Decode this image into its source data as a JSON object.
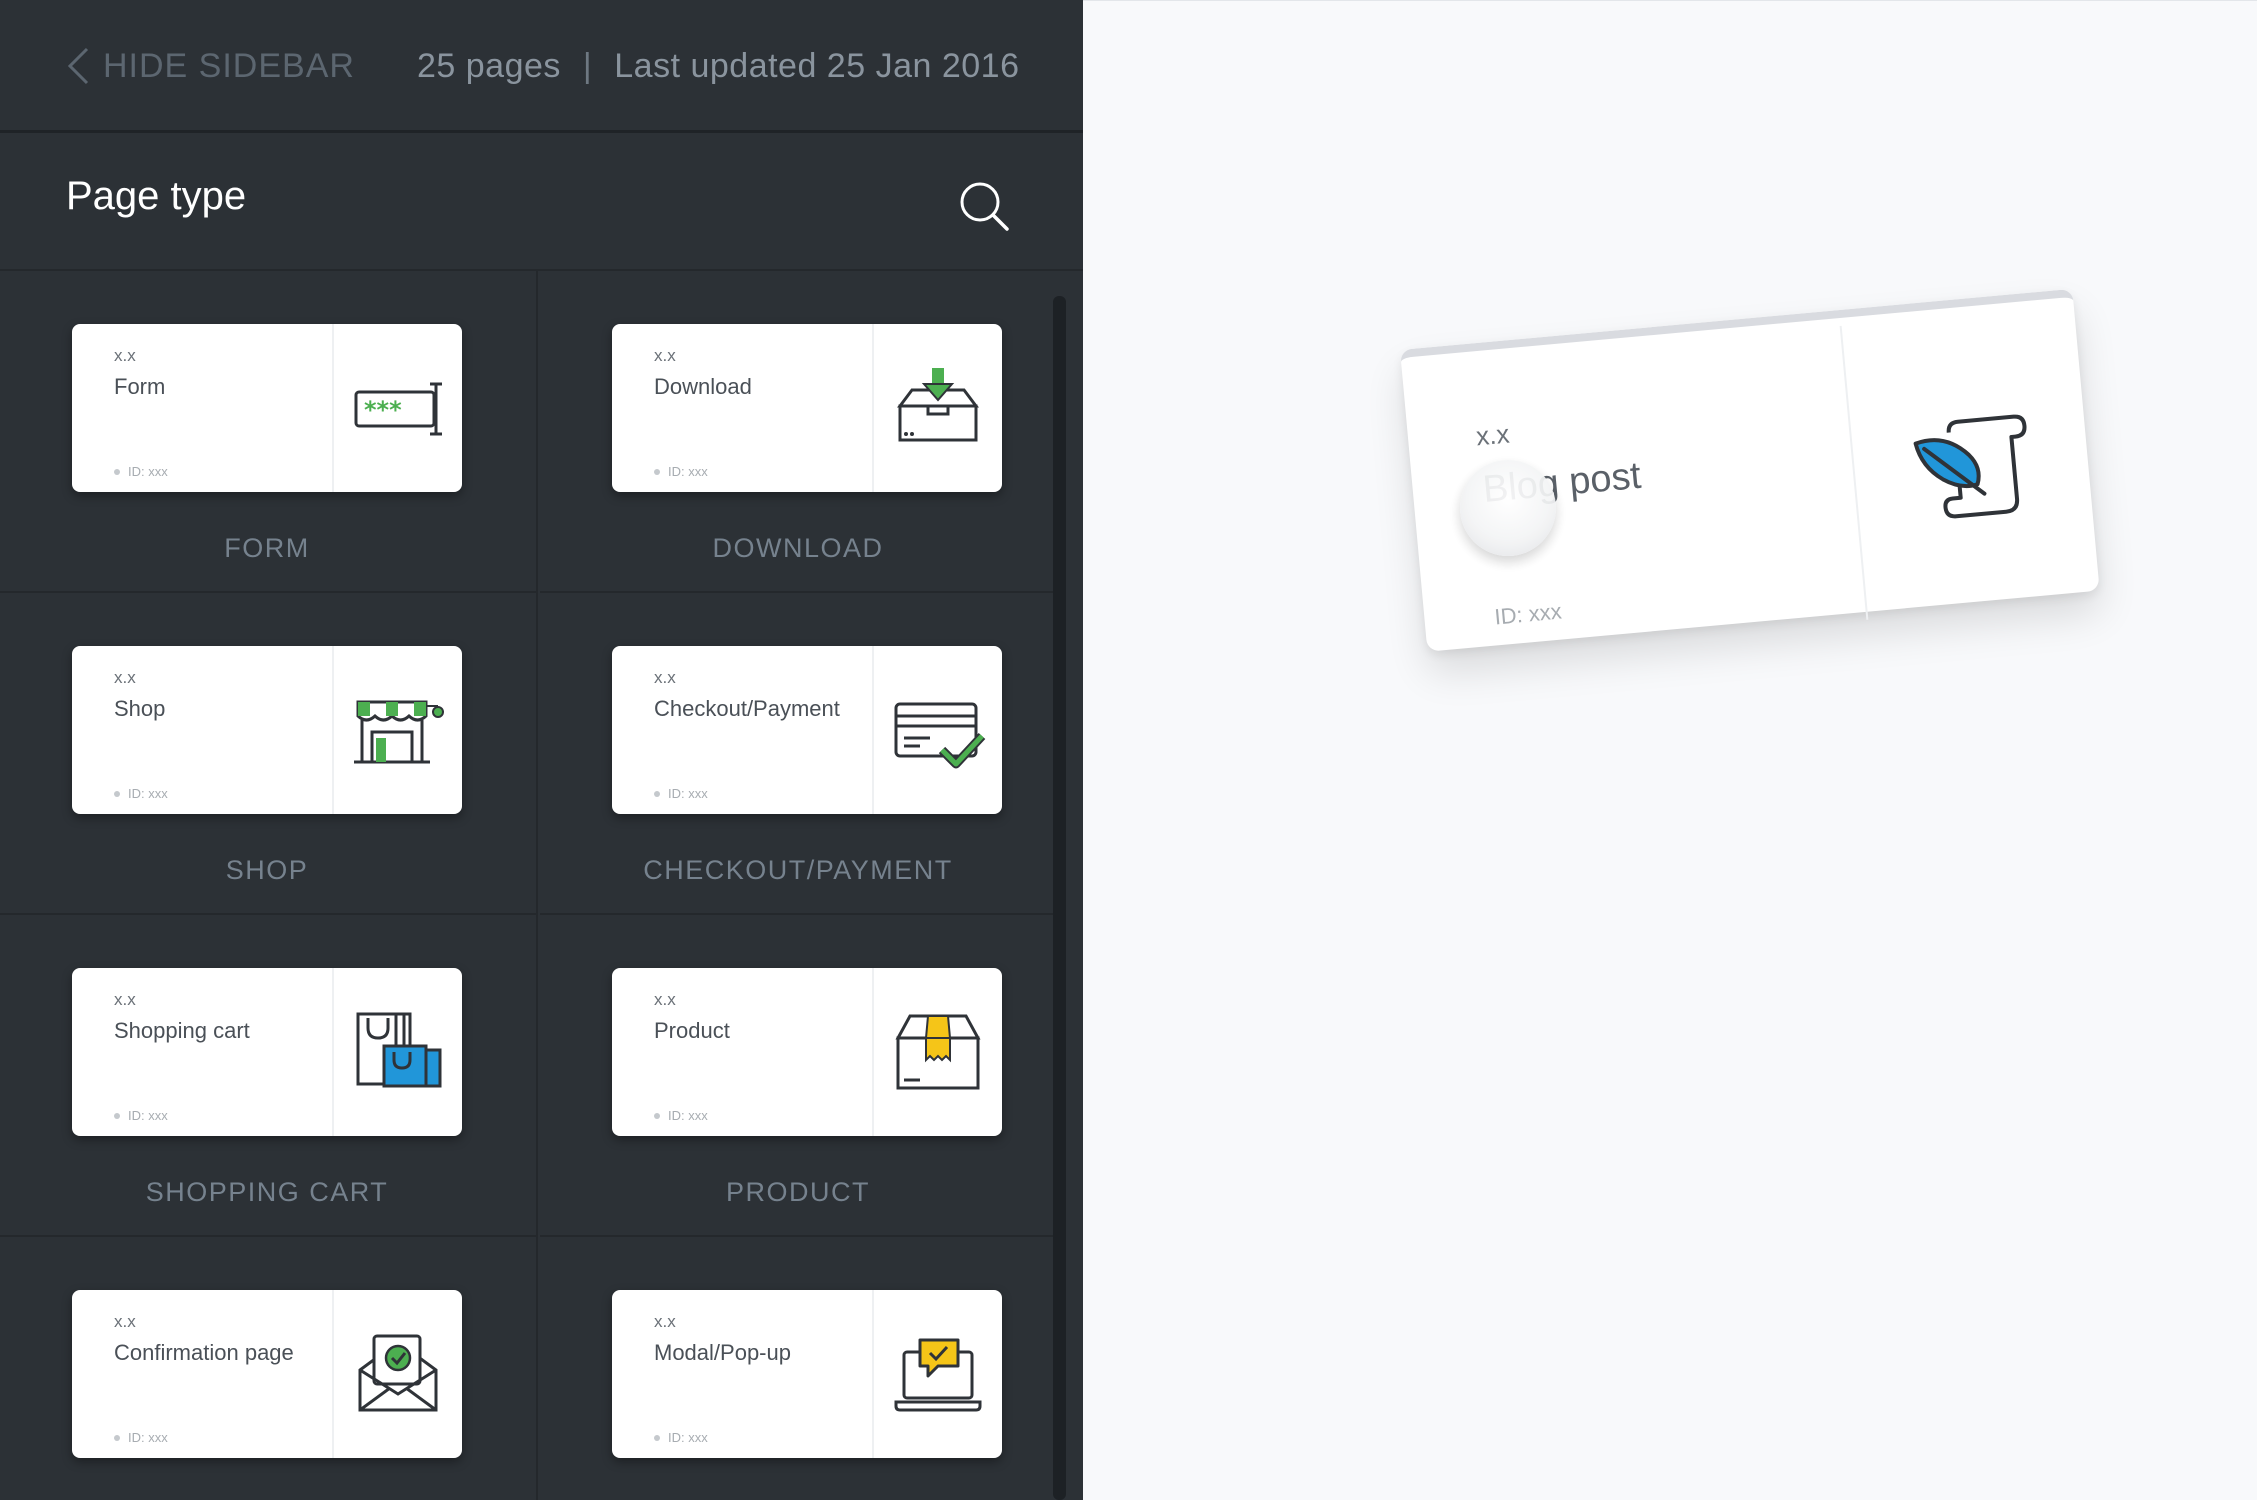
{
  "topbar": {
    "hide_label": "HIDE SIDEBAR",
    "pages_count": "25 pages",
    "separator": "|",
    "last_updated": "Last updated 25 Jan 2016"
  },
  "sidebar": {
    "title": "Page type",
    "items": [
      {
        "version": "x.x",
        "name": "Form",
        "id": "ID: xxx",
        "caption": "FORM",
        "icon": "form-password-icon"
      },
      {
        "version": "x.x",
        "name": "Download",
        "id": "ID: xxx",
        "caption": "DOWNLOAD",
        "icon": "download-box-icon"
      },
      {
        "version": "x.x",
        "name": "Shop",
        "id": "ID: xxx",
        "caption": "SHOP",
        "icon": "shop-storefront-icon"
      },
      {
        "version": "x.x",
        "name": "Checkout/Payment",
        "id": "ID: xxx",
        "caption": "CHECKOUT/PAYMENT",
        "icon": "credit-card-check-icon"
      },
      {
        "version": "x.x",
        "name": "Shopping cart",
        "id": "ID: xxx",
        "caption": "SHOPPING CART",
        "icon": "shopping-bags-icon"
      },
      {
        "version": "x.x",
        "name": "Product",
        "id": "ID: xxx",
        "caption": "PRODUCT",
        "icon": "product-box-icon"
      },
      {
        "version": "x.x",
        "name": "Confirmation page",
        "id": "ID: xxx",
        "caption": "",
        "icon": "confirmation-envelope-icon"
      },
      {
        "version": "x.x",
        "name": "Modal/Pop-up",
        "id": "ID: xxx",
        "caption": "",
        "icon": "laptop-popup-icon"
      }
    ]
  },
  "dragged_card": {
    "version": "x.x",
    "name": "Blog post",
    "id": "ID: xxx",
    "icon": "quill-scroll-icon"
  },
  "colors": {
    "sidebar_bg": "#2c3136",
    "canvas_bg": "#f8f9fb",
    "accent_green": "#4caf50",
    "accent_blue": "#2196d9",
    "accent_yellow": "#f5c518",
    "icon_stroke": "#2f3338"
  }
}
